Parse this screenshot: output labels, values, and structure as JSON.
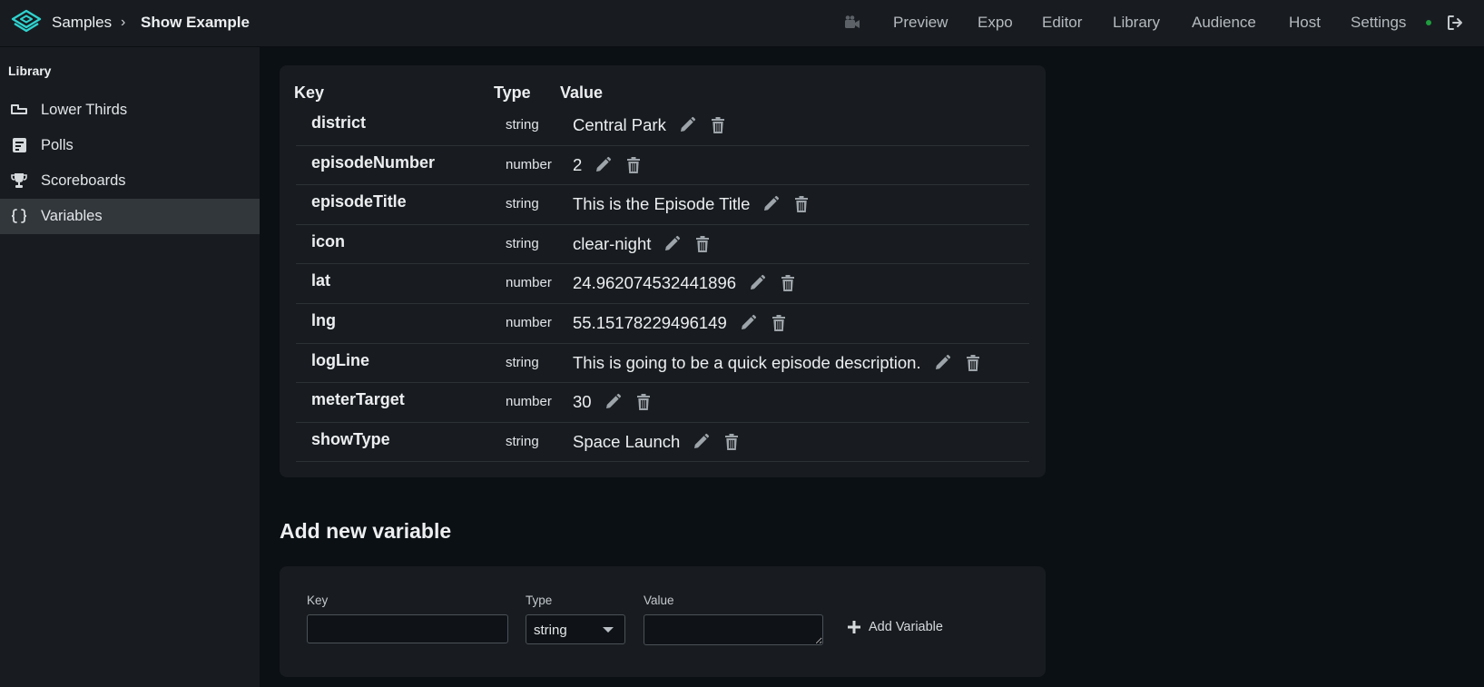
{
  "header": {
    "breadcrumb": {
      "root": "Samples",
      "separator": "›",
      "current": "Show Example"
    },
    "nav": [
      "Preview",
      "Expo",
      "Editor",
      "Library",
      "Audience",
      "Host",
      "Settings"
    ]
  },
  "sidebar": {
    "heading": "Library",
    "items": [
      {
        "label": "Lower Thirds",
        "icon": "lower-thirds-icon"
      },
      {
        "label": "Polls",
        "icon": "poll-icon"
      },
      {
        "label": "Scoreboards",
        "icon": "trophy-icon"
      },
      {
        "label": "Variables",
        "icon": "braces-icon",
        "active": true
      }
    ]
  },
  "table": {
    "columns": {
      "key": "Key",
      "type": "Type",
      "value": "Value"
    },
    "rows": [
      {
        "key": "district",
        "type": "string",
        "value": "Central Park"
      },
      {
        "key": "episodeNumber",
        "type": "number",
        "value": "2"
      },
      {
        "key": "episodeTitle",
        "type": "string",
        "value": "This is the Episode Title"
      },
      {
        "key": "icon",
        "type": "string",
        "value": "clear-night"
      },
      {
        "key": "lat",
        "type": "number",
        "value": "24.962074532441896"
      },
      {
        "key": "lng",
        "type": "number",
        "value": "55.15178229496149"
      },
      {
        "key": "logLine",
        "type": "string",
        "value": "This is going to be a quick episode description."
      },
      {
        "key": "meterTarget",
        "type": "number",
        "value": "30"
      },
      {
        "key": "showType",
        "type": "string",
        "value": "Space Launch"
      }
    ]
  },
  "add_form": {
    "title": "Add new variable",
    "key_label": "Key",
    "type_label": "Type",
    "value_label": "Value",
    "key_value": "",
    "type_selected": "string",
    "value_value": "",
    "submit_label": "Add Variable"
  },
  "colors": {
    "accent": "#2fd3cf",
    "status_online": "#1f9d3f",
    "background": "#0b1014",
    "panel": "#181c20"
  }
}
